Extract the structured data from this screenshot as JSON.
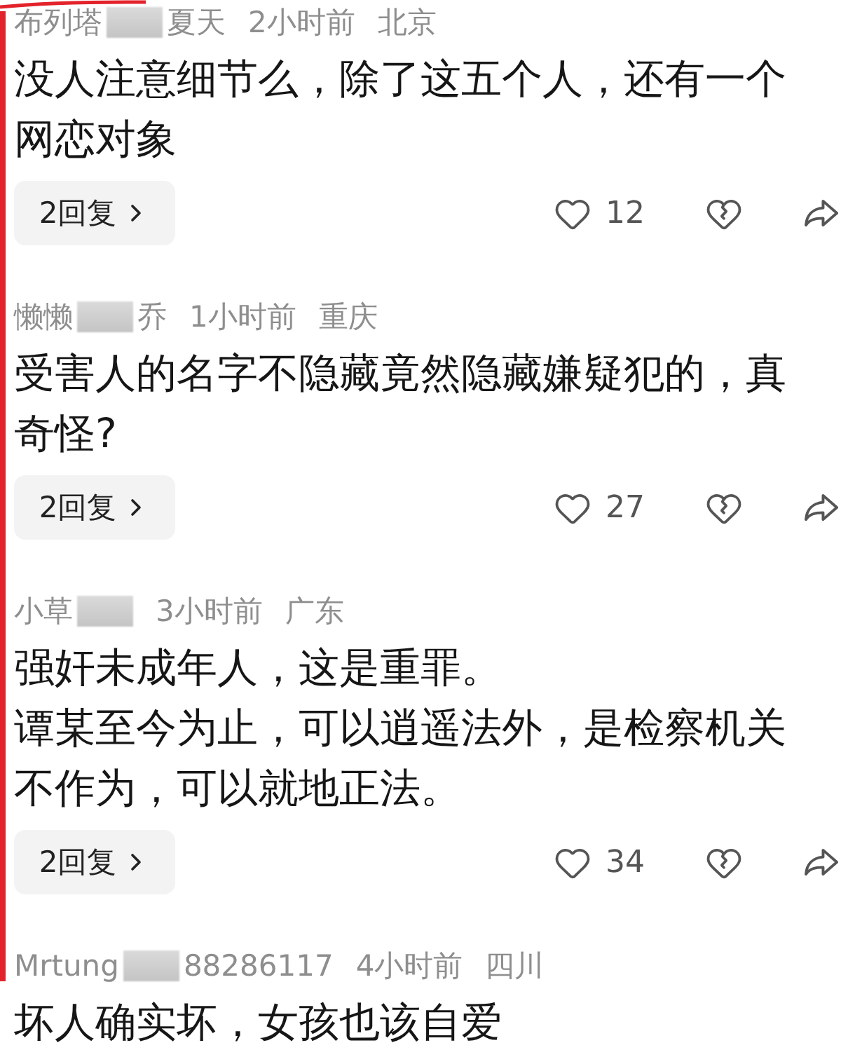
{
  "comments": [
    {
      "author": [
        {
          "kind": "text",
          "text": "布列塔"
        },
        {
          "kind": "blur"
        },
        {
          "kind": "text",
          "text": "夏天"
        }
      ],
      "time": "2小时前",
      "location": "北京",
      "paragraphs": [
        "没人注意细节么，除了这五个人，还有一个网恋对象"
      ],
      "replies": "2回复",
      "likes": "12"
    },
    {
      "author": [
        {
          "kind": "text",
          "text": "懒懒"
        },
        {
          "kind": "blur"
        },
        {
          "kind": "text",
          "text": "乔"
        }
      ],
      "time": "1小时前",
      "location": "重庆",
      "paragraphs": [
        "受害人的名字不隐藏竟然隐藏嫌疑犯的，真奇怪?"
      ],
      "replies": "2回复",
      "likes": "27"
    },
    {
      "author": [
        {
          "kind": "text",
          "text": "小草"
        },
        {
          "kind": "blur"
        }
      ],
      "time": "3小时前",
      "location": "广东",
      "paragraphs": [
        "强奸未成年人，这是重罪。",
        "谭某至今为止，可以逍遥法外，是检察机关不作为，可以就地正法。"
      ],
      "replies": "2回复",
      "likes": "34"
    },
    {
      "author": [
        {
          "kind": "text",
          "text": "Mrtung"
        },
        {
          "kind": "blur"
        },
        {
          "kind": "text",
          "text": "88286117"
        }
      ],
      "time": "4小时前",
      "location": "四川",
      "paragraphs": [
        "坏人确实坏，女孩也该自爱"
      ]
    }
  ]
}
